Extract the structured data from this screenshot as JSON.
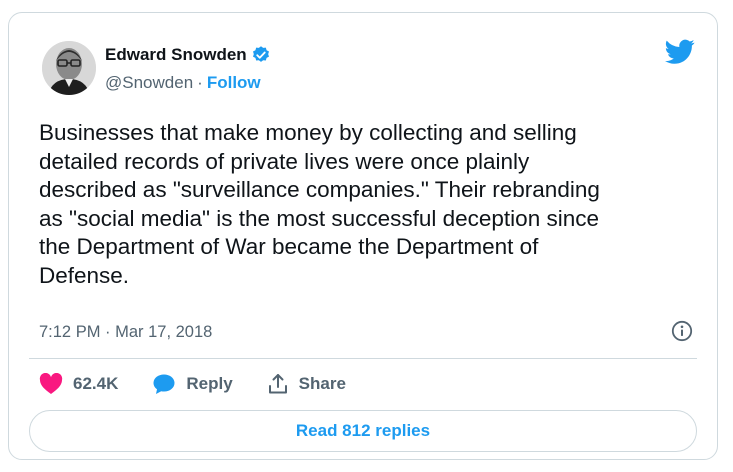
{
  "author": {
    "name": "Edward Snowden",
    "handle": "@Snowden",
    "separator": "·",
    "follow_label": "Follow",
    "verified": true
  },
  "tweet": {
    "text": "Businesses that make money by collecting and selling\ndetailed records of private lives were once plainly\ndescribed as \"surveillance companies.\" Their rebranding\nas \"social media\" is the most successful deception since\nthe Department of War became the Department of\nDefense.",
    "timestamp": "7:12 PM · Mar 17, 2018"
  },
  "actions": {
    "likes": "62.4K",
    "reply_label": "Reply",
    "share_label": "Share"
  },
  "footer": {
    "read_replies_label": "Read 812 replies"
  },
  "colors": {
    "accent": "#1d9bf0",
    "like": "#f91880",
    "text": "#0f1419",
    "muted": "#536471",
    "border": "#cfd9de"
  },
  "icons": {
    "brand": "twitter-bird-icon",
    "verified": "verified-badge-icon",
    "info": "info-icon",
    "like": "heart-icon",
    "reply": "speech-bubble-icon",
    "share": "share-upload-icon"
  }
}
